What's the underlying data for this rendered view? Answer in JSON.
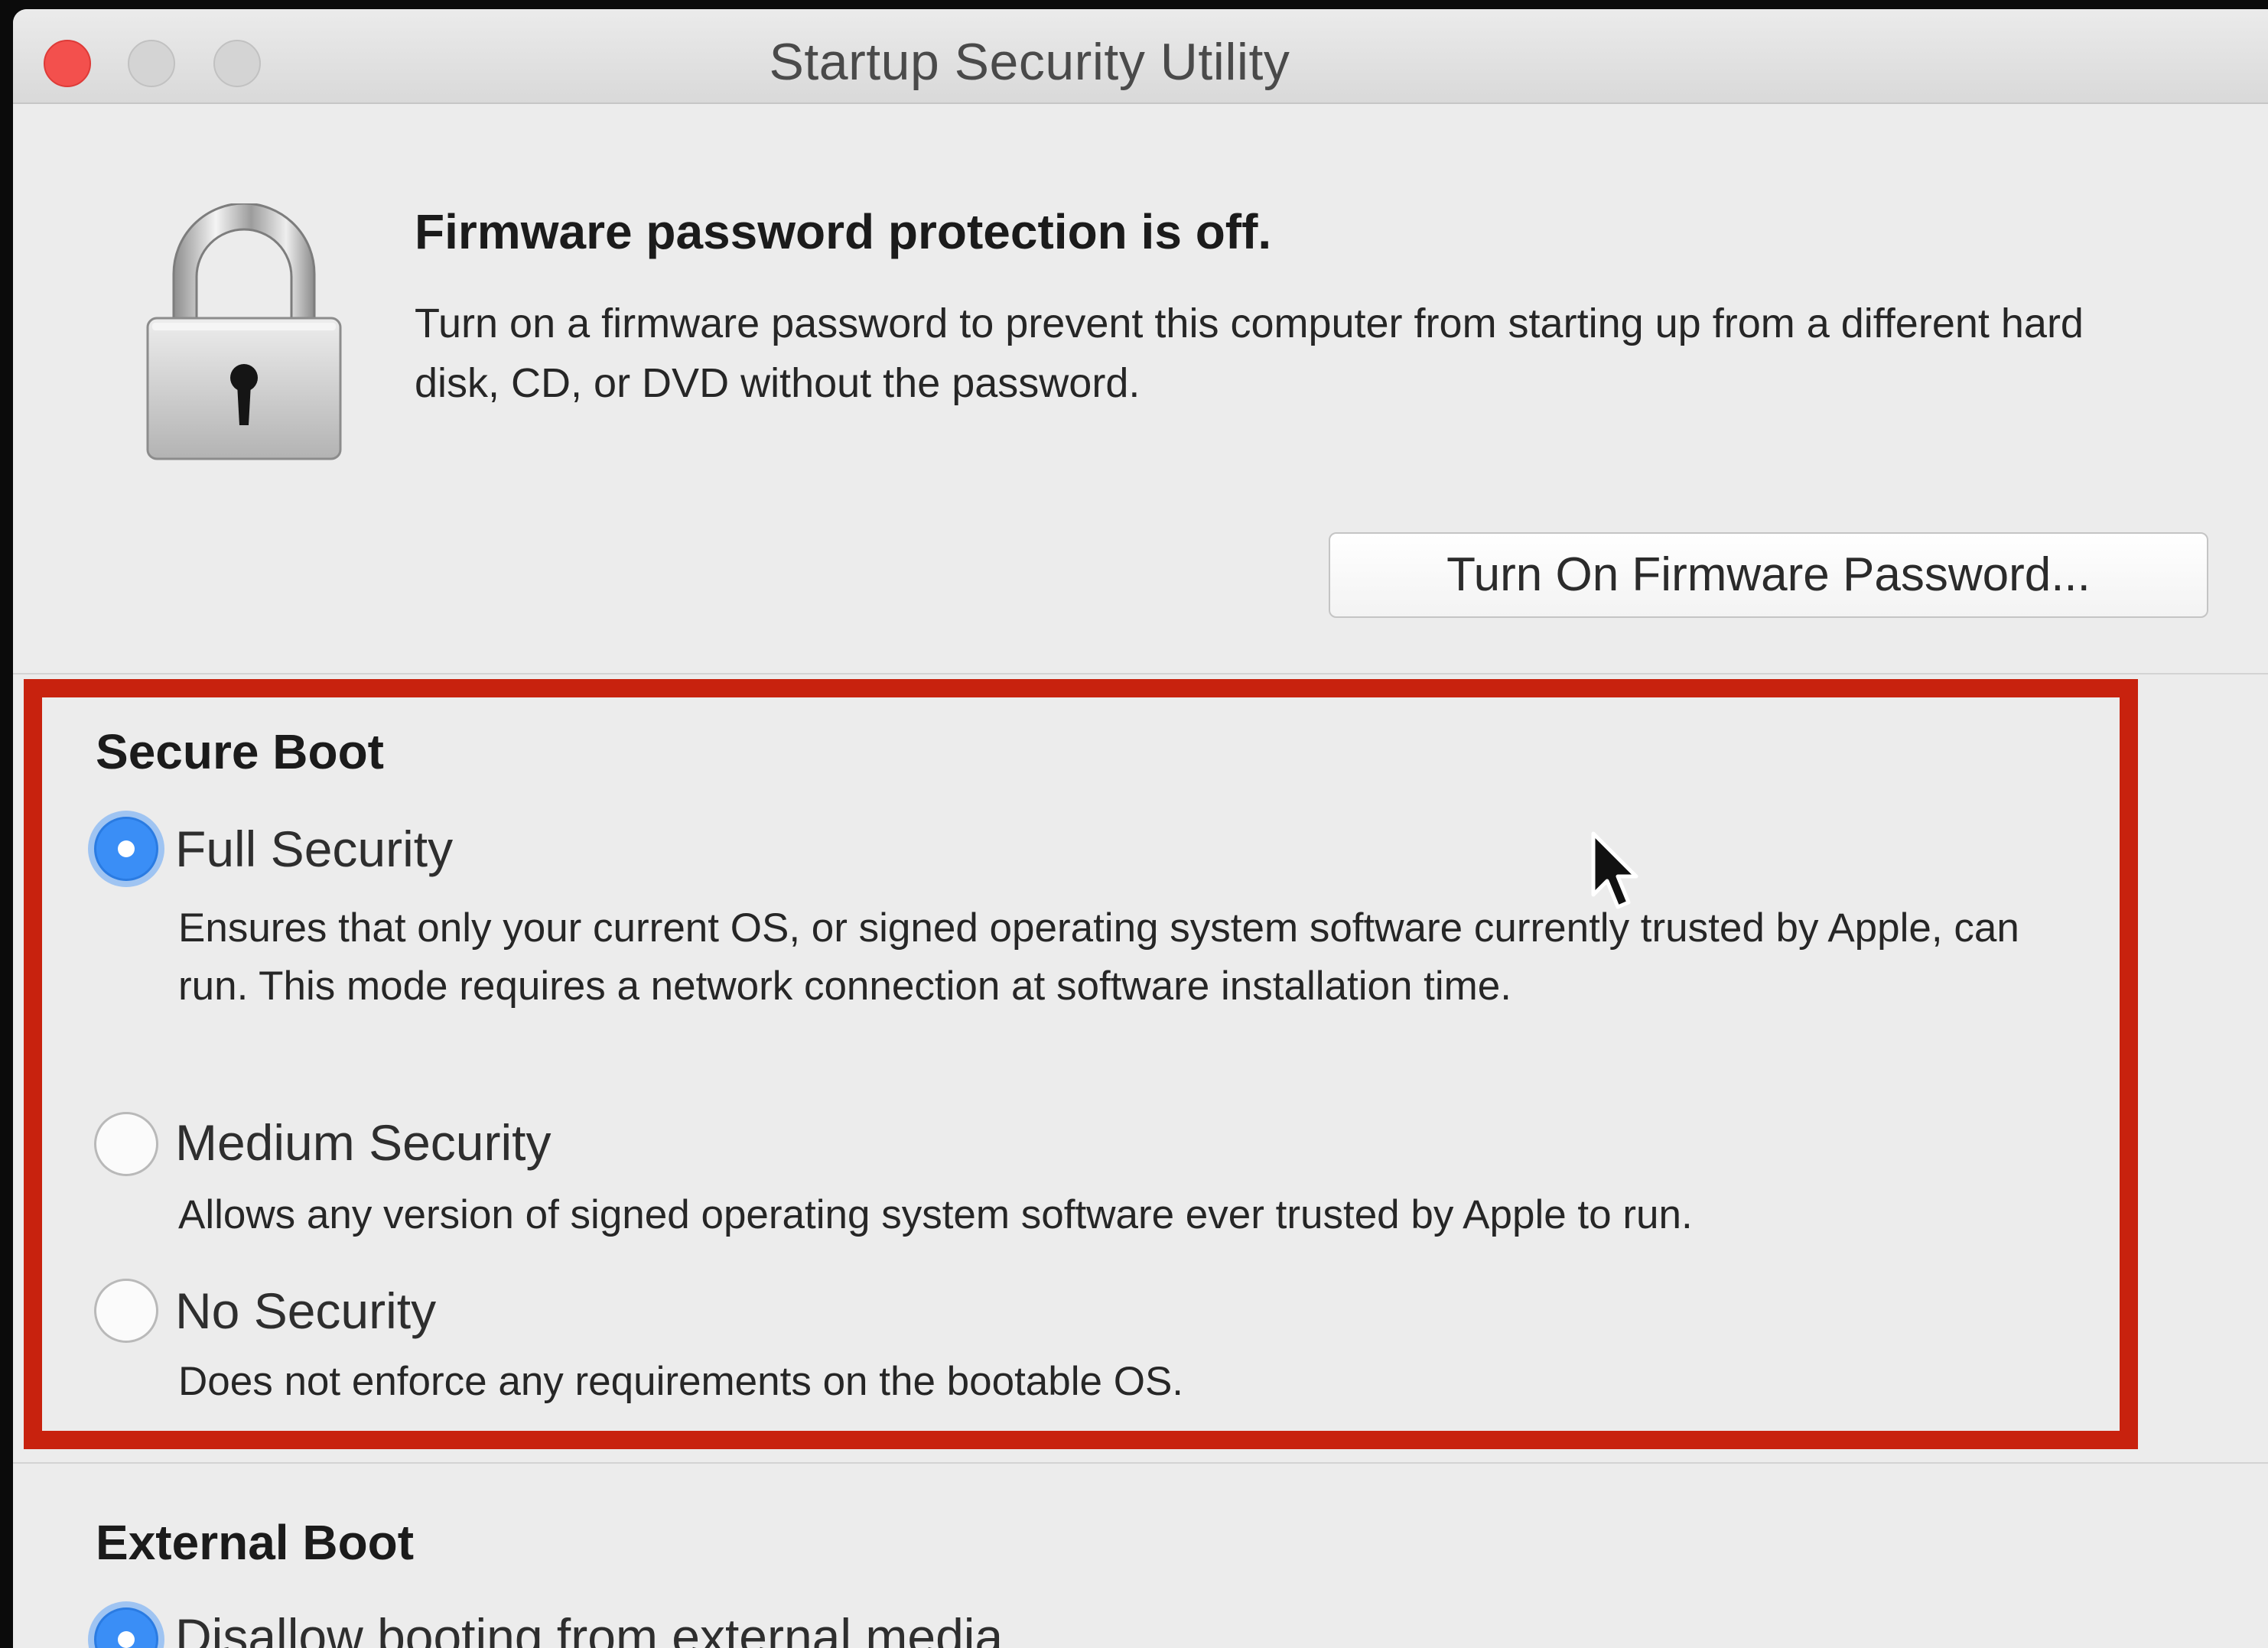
{
  "window": {
    "title": "Startup Security Utility"
  },
  "firmware": {
    "heading": "Firmware password protection is off.",
    "description": "Turn on a firmware password to prevent this computer from starting up from a different hard disk, CD, or DVD without the password.",
    "button_label": "Turn On Firmware Password..."
  },
  "secure_boot": {
    "title": "Secure Boot",
    "selected": "full",
    "options": [
      {
        "label": "Full Security",
        "description": "Ensures that only your current OS, or signed operating system software currently trusted by Apple, can run. This mode requires a network connection at software installation time."
      },
      {
        "label": "Medium Security",
        "description": "Allows any version of signed operating system software ever trusted by Apple to run."
      },
      {
        "label": "No Security",
        "description": "Does not enforce any requirements on the bootable OS."
      }
    ]
  },
  "external_boot": {
    "title": "External Boot",
    "options": [
      {
        "label": "Disallow booting from external media"
      }
    ]
  },
  "colors": {
    "highlight_border": "#c8220e",
    "radio_selected": "#3a8ef6",
    "close_button": "#f3504d"
  },
  "icons": [
    "lock-icon",
    "pointer-cursor-icon"
  ]
}
